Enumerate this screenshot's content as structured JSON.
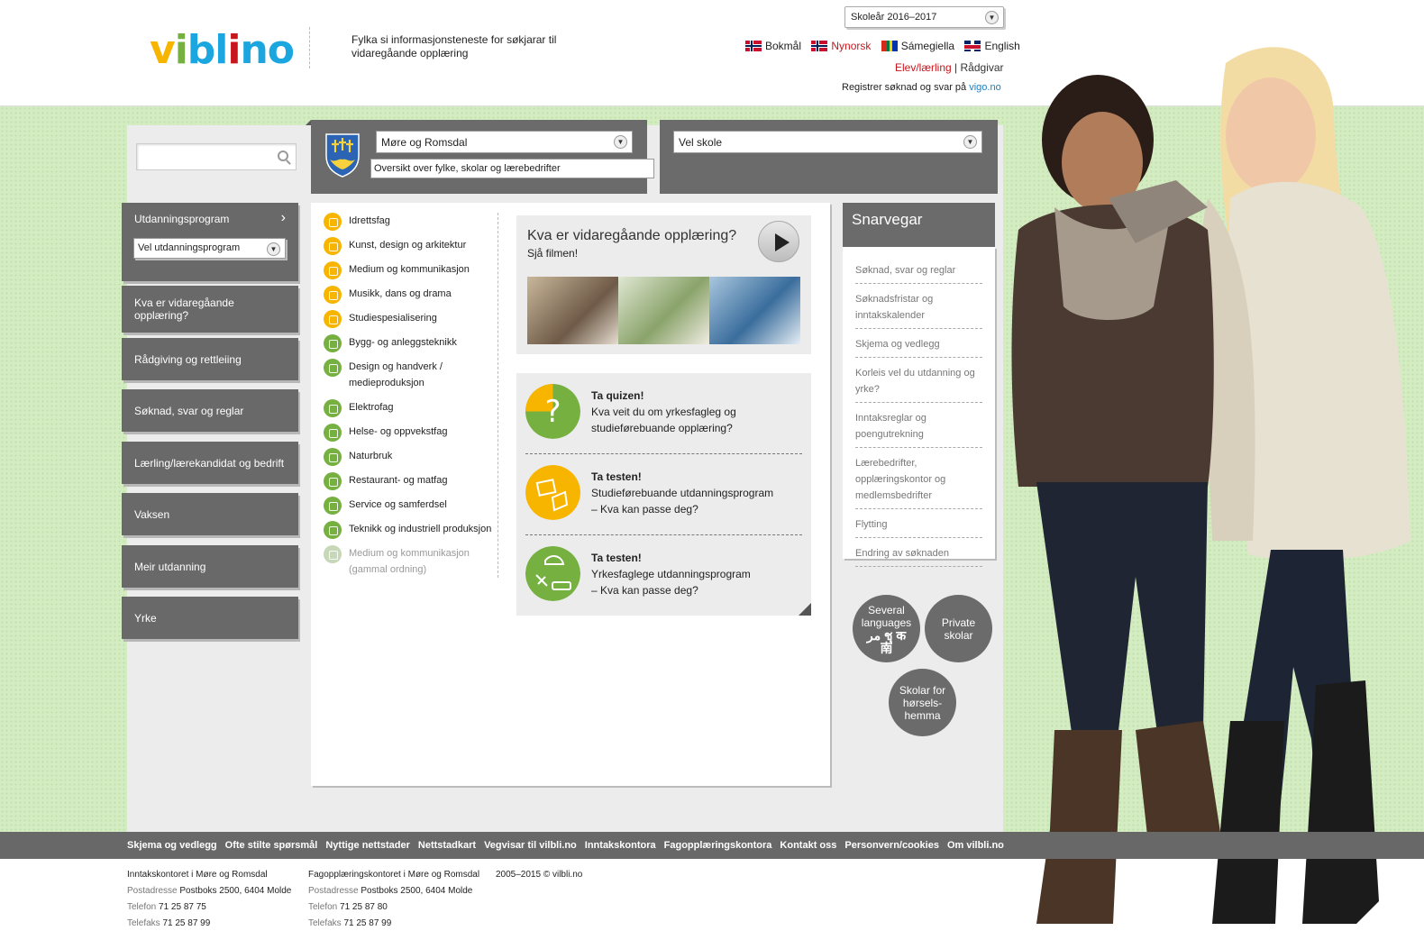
{
  "header": {
    "logo_letters": [
      "v",
      "i",
      "b",
      "l",
      "i",
      "n",
      "o"
    ],
    "tagline": "Fylka si informasjonsteneste for søkjarar til vidaregåande opplæring",
    "school_year": "Skoleår 2016–2017",
    "languages": [
      {
        "label": "Bokmål"
      },
      {
        "label": "Nynorsk"
      },
      {
        "label": "Sámegiella"
      },
      {
        "label": "English"
      }
    ],
    "role_elev": "Elev/lærling",
    "role_separator": "|",
    "role_raadgivar": "Rådgivar",
    "register_text": "Registrer søknad og svar på",
    "register_link": "vigo.no"
  },
  "colors": {
    "logo_blue": "#1ba6e0",
    "logo_yellow": "#f7b500",
    "logo_red": "#c7161d",
    "logo_green": "#76b041",
    "nav_gray": "#696969",
    "bg_green": "#d4ecc2",
    "accent_red": "#c7161d",
    "link_blue": "#1a7fc1"
  },
  "search": {
    "placeholder": ""
  },
  "nav": {
    "first_label": "Utdanningsprogram",
    "first_chevron": "›",
    "select_value": "Vel utdanningsprogram",
    "items": [
      "Kva er vidaregåande opplæring?",
      "Rådgiving og rettleiing",
      "Søknad, svar og reglar",
      "Lærling/lærekandidat og bedrift",
      "Vaksen",
      "Meir utdanning",
      "Yrke"
    ]
  },
  "region": {
    "fylke_value": "Møre og Romsdal",
    "fylke_sub": "Oversikt over fylke, skolar og lærebedrifter",
    "school_value": "Vel skole"
  },
  "programs": [
    {
      "label": "Idrettsfag",
      "color": "yellow",
      "icon": "sport-icon"
    },
    {
      "label": "Kunst, design og arkitektur",
      "color": "yellow",
      "icon": "art-icon"
    },
    {
      "label": "Medium og kommunikasjon",
      "color": "yellow",
      "icon": "media-icon"
    },
    {
      "label": "Musikk, dans og drama",
      "color": "yellow",
      "icon": "music-icon"
    },
    {
      "label": "Studiespesialisering",
      "color": "yellow",
      "icon": "book-icon"
    },
    {
      "label": "Bygg- og anleggsteknikk",
      "color": "green",
      "icon": "helmet-icon"
    },
    {
      "label": "Design og handverk / medieproduksjon",
      "color": "green",
      "icon": "scissors-icon"
    },
    {
      "label": "Elektrofag",
      "color": "green",
      "icon": "plug-icon"
    },
    {
      "label": "Helse- og oppvekstfag",
      "color": "green",
      "icon": "bandage-icon"
    },
    {
      "label": "Naturbruk",
      "color": "green",
      "icon": "leaf-icon"
    },
    {
      "label": "Restaurant- og matfag",
      "color": "green",
      "icon": "cutlery-icon"
    },
    {
      "label": "Service og samferdsel",
      "color": "green",
      "icon": "bus-icon"
    },
    {
      "label": "Teknikk og industriell produksjon",
      "color": "green",
      "icon": "gear-icon"
    },
    {
      "label": "Medium og kommunikasjon (gammal ordning)",
      "color": "gray",
      "icon": "camera-icon"
    }
  ],
  "video": {
    "title": "Kva er vidaregåande opplæring?",
    "subtitle": "Sjå filmen!"
  },
  "quizzes": [
    {
      "title": "Ta quizen!",
      "line1": "Kva veit du om yrkesfagleg og",
      "line2": "studieførebuande opplæring?",
      "icon": "question-icon"
    },
    {
      "title": "Ta testen!",
      "line1": "Studieførebuande utdanningsprogram",
      "line2": "– Kva kan passe deg?",
      "icon": "study-test-icon"
    },
    {
      "title": "Ta testen!",
      "line1": "Yrkesfaglege utdanningsprogram",
      "line2": "– Kva kan passe deg?",
      "icon": "vocational-test-icon"
    }
  ],
  "snarvegar": {
    "title": "Snarvegar",
    "links": [
      "Søknad, svar og reglar",
      "Søknadsfristar og inntakskalender",
      "Skjema og vedlegg",
      "Korleis vel du utdanning og yrke?",
      "Inntaksreglar og poengutrekning",
      "Lærebedrifter, opplæringskontor og medlemsbedrifter",
      "Flytting",
      "Endring av søknaden"
    ]
  },
  "round_buttons": {
    "languages_l1": "Several",
    "languages_l2": "languages",
    "languages_glyphs": "ﻣﺮ ชุ क",
    "languages_glyph2": "南",
    "private_l1": "Private",
    "private_l2": "skolar",
    "hearing_l1": "Skolar for",
    "hearing_l2": "hørsels-",
    "hearing_l3": "hemma"
  },
  "footer": {
    "links": [
      "Skjema og vedlegg",
      "Ofte stilte spørsmål",
      "Nyttige nettstader",
      "Nettstadkart",
      "Vegvisar til vilbli.no",
      "Inntakskontora",
      "Fagopplæringskontora",
      "Kontakt oss",
      "Personvern/cookies",
      "Om vilbli.no"
    ],
    "col1": {
      "title": "Inntakskontoret i Møre og Romsdal",
      "addr_label": "Postadresse",
      "addr": "Postboks 2500, 6404 Molde",
      "tel_label": "Telefon",
      "tel": "71 25 87 75",
      "fax_label": "Telefaks",
      "fax": "71 25 87 99"
    },
    "col2": {
      "title": "Fagopplæringskontoret i Møre og Romsdal",
      "addr_label": "Postadresse",
      "addr": "Postboks 2500, 6404 Molde",
      "tel_label": "Telefon",
      "tel": "71 25 87 80",
      "fax_label": "Telefaks",
      "fax": "71 25 87 99"
    },
    "copyright": "2005–2015 © vilbli.no"
  }
}
